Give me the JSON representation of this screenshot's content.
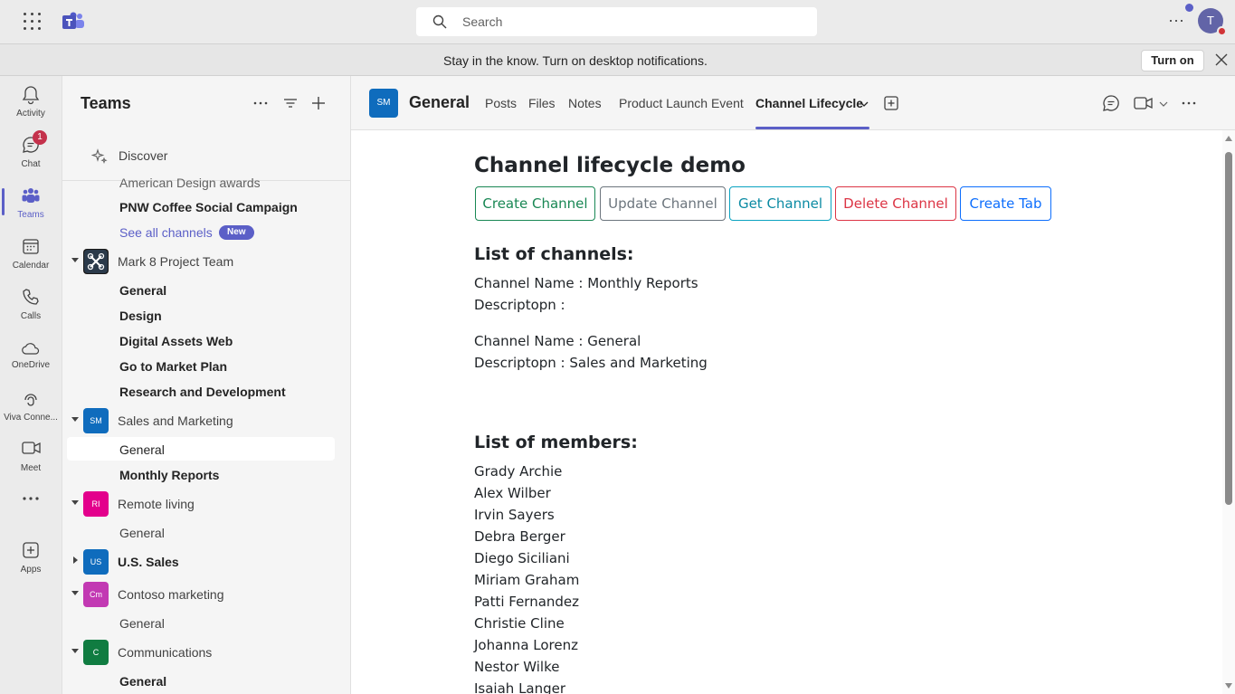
{
  "search": {
    "placeholder": "Search"
  },
  "avatar": {
    "initials": "T"
  },
  "notification": {
    "message": "Stay in the know. Turn on desktop notifications.",
    "button": "Turn on"
  },
  "rail": {
    "activity": "Activity",
    "chat": "Chat",
    "chat_badge": "1",
    "teams": "Teams",
    "calendar": "Calendar",
    "calls": "Calls",
    "onedrive": "OneDrive",
    "viva": "Viva Conne...",
    "meet": "Meet",
    "apps": "Apps"
  },
  "panel": {
    "title": "Teams",
    "discover": "Discover",
    "clipped_channel": "American Design awards",
    "pnw_channel": "PNW Coffee Social Campaign",
    "see_all": "See all channels",
    "new_pill": "New",
    "teams": [
      {
        "name": "Mark 8 Project Team",
        "avatar": "",
        "color": "#1b1a19",
        "channels": [
          "General",
          "Design",
          "Digital Assets Web",
          "Go to Market Plan",
          "Research and Development"
        ]
      },
      {
        "name": "Sales and Marketing",
        "avatar": "SM",
        "color": "#0f6cbd",
        "channels": [
          "General",
          "Monthly Reports"
        ]
      },
      {
        "name": "Remote living",
        "avatar": "RI",
        "color": "#e3008c",
        "channels": [
          "General"
        ]
      },
      {
        "name": "U.S. Sales",
        "avatar": "US",
        "color": "#0f6cbd",
        "channels": []
      },
      {
        "name": "Contoso marketing",
        "avatar": "Cm",
        "color": "#c239b3",
        "channels": [
          "General"
        ]
      },
      {
        "name": "Communications",
        "avatar": "C",
        "color": "#107c41",
        "channels": [
          "General"
        ]
      }
    ]
  },
  "channel": {
    "avatar": "SM",
    "name": "General",
    "tabs": [
      "Posts",
      "Files",
      "Notes",
      "Product Launch Event",
      "Channel Lifecycle"
    ]
  },
  "app": {
    "title": "Channel lifecycle demo",
    "buttons": [
      "Create Channel",
      "Update Channel",
      "Get Channel",
      "Delete Channel",
      "Create Tab"
    ],
    "channels_heading": "List of channels:",
    "channels": [
      {
        "name_line": "Channel Name : Monthly Reports",
        "desc_line": "Descriptopn :"
      },
      {
        "name_line": "Channel Name : General",
        "desc_line": "Descriptopn : Sales and Marketing"
      }
    ],
    "members_heading": "List of members:",
    "members": [
      "Grady Archie",
      "Alex Wilber",
      "Irvin Sayers",
      "Debra Berger",
      "Diego Siciliani",
      "Miriam Graham",
      "Patti Fernandez",
      "Christie Cline",
      "Johanna Lorenz",
      "Nestor Wilke",
      "Isaiah Langer"
    ]
  },
  "colors": {
    "brand": "#5b5fc7",
    "btn_success": "#198754",
    "btn_secondary": "#6c757d",
    "btn_info": "#0dcaf0",
    "btn_danger": "#dc3545",
    "btn_primary": "#0d6efd"
  }
}
